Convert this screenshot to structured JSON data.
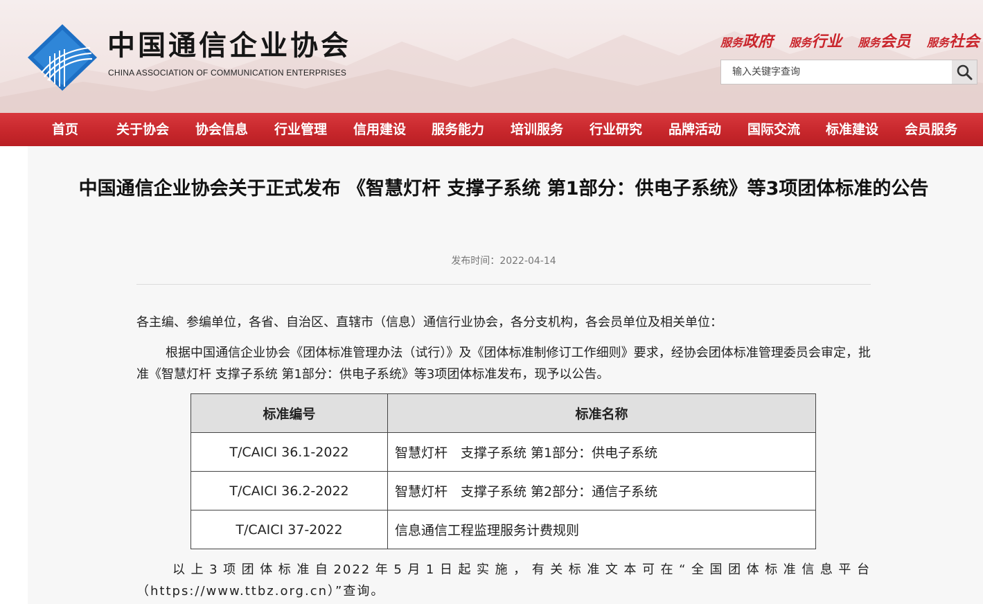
{
  "site": {
    "name_cn": "中国通信企业协会",
    "name_en": "CHINA ASSOCIATION OF COMMUNICATION ENTERPRISES",
    "slogan": [
      {
        "prefix": "服务",
        "word": "政府"
      },
      {
        "prefix": "服务",
        "word": "行业"
      },
      {
        "prefix": "服务",
        "word": "会员"
      },
      {
        "prefix": "服务",
        "word": "社会"
      }
    ],
    "search_placeholder": "输入关键字查询"
  },
  "colors": {
    "brand_red": "#c9242b",
    "logo_blue": "#1d6fc4"
  },
  "nav": [
    "首页",
    "关于协会",
    "协会信息",
    "行业管理",
    "信用建设",
    "服务能力",
    "培训服务",
    "行业研究",
    "品牌活动",
    "国际交流",
    "标准建设",
    "会员服务"
  ],
  "article": {
    "title": "中国通信企业协会关于正式发布 《智慧灯杆 支撑子系统 第1部分：供电子系统》等3项团体标准的公告",
    "date_label": "发布时间：",
    "date": "2022-04-14",
    "salutation": "各主编、参编单位，各省、自治区、直辖市（信息）通信行业协会，各分支机构，各会员单位及相关单位：",
    "body": "根据中国通信企业协会《团体标准管理办法（试行）》及《团体标准制修订工作细则》要求，经协会团体标准管理委员会审定，批准《智慧灯杆 支撑子系统 第1部分：供电子系统》等3项团体标准发布，现予以公告。",
    "table": {
      "headers": [
        "标准编号",
        "标准名称"
      ],
      "rows": [
        [
          "T/CAICI 36.1-2022",
          "智慧灯杆　支撑子系统 第1部分：供电子系统"
        ],
        [
          "T/CAICI 36.2-2022",
          "智慧灯杆　支撑子系统 第2部分：通信子系统"
        ],
        [
          "T/CAICI 37-2022",
          "信息通信工程监理服务计费规则"
        ]
      ]
    },
    "footer": "以上3项团体标准自2022年5月1日起实施，有关标准文本可在“全国团体标准信息平台（https://www.ttbz.org.cn）”查询。"
  }
}
